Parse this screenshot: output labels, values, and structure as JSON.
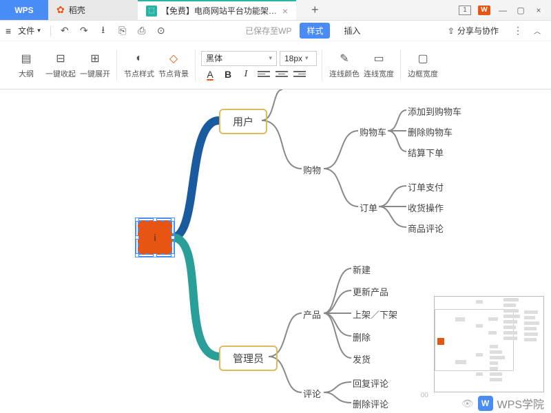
{
  "titlebar": {
    "tabs": [
      {
        "label": "WPS",
        "type": "wps"
      },
      {
        "label": "稻壳",
        "type": "daoke"
      },
      {
        "label": "【免费】电商网站平台功能架构图",
        "type": "doc"
      }
    ],
    "window_controls": {
      "tab_count": "1",
      "logo": "W"
    }
  },
  "toolbar1": {
    "file_menu": "文件",
    "saved_text": "已保存至WP",
    "style_btn": "样式",
    "insert_btn": "插入",
    "share_btn": "分享与协作"
  },
  "toolbar2": {
    "outline": "大纲",
    "collapse_all": "一键收起",
    "expand_all": "一键展开",
    "node_style": "节点样式",
    "node_bg": "节点背景",
    "font_family": "黑体",
    "font_size": "18px",
    "line_color": "连线颜色",
    "line_width": "连线宽度",
    "border_width": "边框宽度"
  },
  "mindmap": {
    "root": "i",
    "user": "用户",
    "admin": "管理员",
    "shopping": "购物",
    "cart": "购物车",
    "cart_add": "添加到购物车",
    "cart_del": "删除购物车",
    "checkout": "结算下单",
    "order": "订单",
    "order_pay": "订单支付",
    "order_recv": "收货操作",
    "order_comment": "商品评论",
    "product": "产品",
    "p_new": "新建",
    "p_update": "更新产品",
    "p_shelf": "上架／下架",
    "p_delete": "删除",
    "p_ship": "发货",
    "comment": "评论",
    "c_reply": "回复评论",
    "c_delete": "删除评论"
  },
  "watermark": {
    "text": "WPS学院"
  },
  "zoom": "00"
}
